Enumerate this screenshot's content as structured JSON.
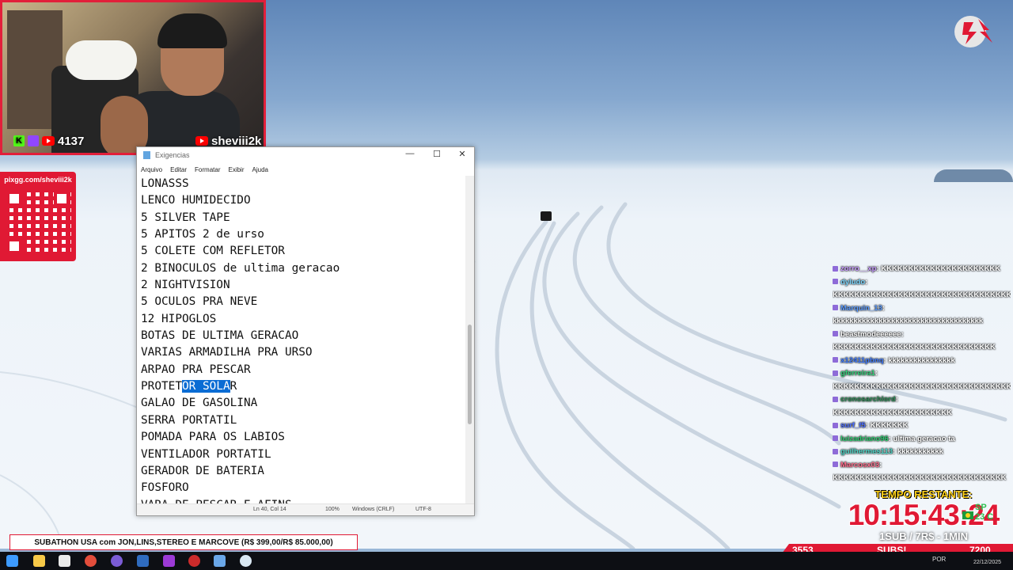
{
  "webcam": {
    "viewer_count": "4137",
    "channel": "sheviii2k",
    "kick_letter": "K"
  },
  "pix": {
    "label": "pixgg.com/sheviii2k"
  },
  "notepad": {
    "title": "Exigencias",
    "menu": [
      "Arquivo",
      "Editar",
      "Formatar",
      "Exibir",
      "Ajuda"
    ],
    "controls": {
      "minimize": "—",
      "maximize": "☐",
      "close": "✕"
    },
    "lines": [
      "LONASSS",
      "LENCO HUMIDECIDO",
      "5 SILVER TAPE",
      "5 APITOS 2 de urso",
      "5 COLETE COM REFLETOR",
      "2 BINOCULOS de ultima geracao",
      "2 NIGHTVISION",
      "5 OCULOS PRA NEVE",
      "12 HIPOGLOS",
      "BOTAS DE ULTIMA GERACAO",
      "VARIAS ARMADILHA PRA URSO",
      "ARPAO PRA PESCAR"
    ],
    "selected_line": {
      "before": "PROTET",
      "selected": "OR SOLA",
      "after": "R"
    },
    "lines_after": [
      "GALAO DE GASOLINA",
      "SERRA PORTATIL",
      "POMADA PARA OS LABIOS",
      "VENTILADOR PORTATIL",
      "GERADOR DE BATERIA",
      "FOSFORO",
      "VARA DE PESCAR E AFINS"
    ],
    "status": {
      "position": "Ln 40, Col 14",
      "zoom": "100%",
      "line_endings": "Windows (CRLF)",
      "encoding": "UTF-8"
    }
  },
  "chat": [
    {
      "user": "zorro__xp",
      "text": "KKKKKKKKKKKKKKKKKKKKKK",
      "color": "#c89bff"
    },
    {
      "user": "dyludo",
      "text": "KKKKKKKKKKKKKKKKKKKKKKKKKKKKKKKKKK",
      "color": "#7ad6ff"
    },
    {
      "user": "Marquin_13",
      "text": "kkkkkkkkkkkkkkkkkkkkkkkkkkkkkkkkkkkk",
      "color": "#5a9bff"
    },
    {
      "user": "beastmodeeeeee",
      "text": "KKKKKKKKKKKKKKKKKKKKKKKKKKKKKK",
      "color": "#ffffff"
    },
    {
      "user": "x12411pbnq",
      "text": "kkkkkkkkkkkkkkkk",
      "color": "#3f7bff"
    },
    {
      "user": "gferreira1",
      "text": "KKKKKKKKKKKKKKKKKKKKKKKKKKKKKKKKKKKKKKKK",
      "color": "#33d17a"
    },
    {
      "user": "cronosarchlord",
      "text": "KKKKKKKKKKKKKKKKKKKKKK",
      "color": "#2e8b57"
    },
    {
      "user": "surf_f5",
      "text": "KKKKKKK",
      "color": "#4c6fff"
    },
    {
      "user": "luizadriano96",
      "text": "ultima geracao ta",
      "color": "#2ecc71"
    },
    {
      "user": "guilhermes113",
      "text": "kkkkkkkkkkk",
      "color": "#4fd6c8"
    },
    {
      "user": "Marcosx03",
      "text": "",
      "color": "#ff6b8b"
    },
    {
      "user": "",
      "text": "KKKKKKKKKKKKKKKKKKKKKKKKKKKKKKKK",
      "color": "#ffffff"
    }
  ],
  "timer": {
    "label": "TEMPO RESTANTE:",
    "value": "10:15:43:24",
    "rate": "1SUB / 7R$ - 1MIN",
    "state": "SP",
    "temp": "23 C"
  },
  "banner": {
    "text": "SUBATHON USA com JON,LINS,STEREO E MARCOVE (R$ 399,00/R$ 85.000,00)"
  },
  "subbar": {
    "left_count": "3553",
    "label": "SUBS!",
    "right_count": "7200"
  },
  "taskbar": {
    "lang": "POR",
    "date": "22/12/2025"
  }
}
